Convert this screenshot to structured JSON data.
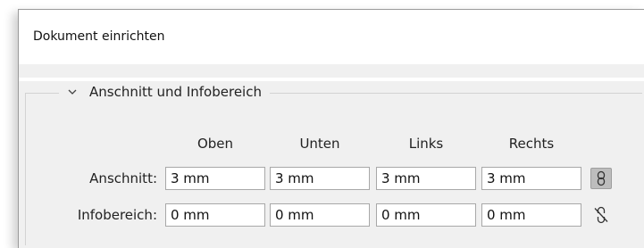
{
  "dialog": {
    "title": "Dokument einrichten"
  },
  "section": {
    "title": "Anschnitt und Infobereich",
    "expand_icon": "chevron-down-icon",
    "columns": [
      "Oben",
      "Unten",
      "Links",
      "Rechts"
    ],
    "rows": [
      {
        "label": "Anschnitt:",
        "values": [
          "3 mm",
          "3 mm",
          "3 mm",
          "3 mm"
        ],
        "link_icon": "link-chain-icon",
        "link_active": true
      },
      {
        "label": "Infobereich:",
        "values": [
          "0 mm",
          "0 mm",
          "0 mm",
          "0 mm"
        ],
        "link_icon": "broken-link-chain-icon",
        "link_active": false
      }
    ]
  },
  "colors": {
    "dialog_background": "#f0f0f0",
    "title_background": "#ffffff",
    "field_border": "#a8a8a8",
    "link_button_active": "#bdbdbd"
  }
}
